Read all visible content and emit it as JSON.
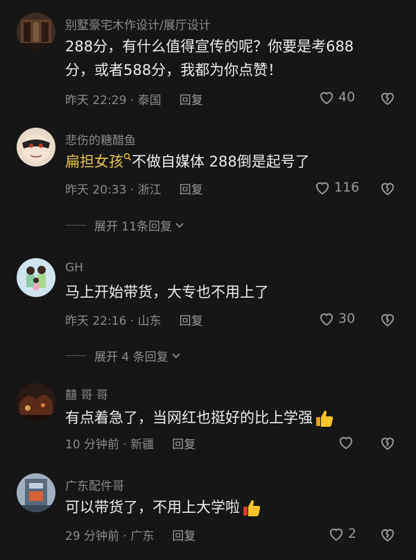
{
  "comments": [
    {
      "username": "别墅豪宅木作设计/展厅设计",
      "text": "288分，有什么值得宣传的呢？你要是考688分，或者588分，我都为你点赞！",
      "meta": "昨天 22:29 · 泰国",
      "reply": "回复",
      "likes": "40"
    },
    {
      "username": "悲伤的糖醋鱼",
      "mention": "扁担女孩",
      "text": "不做自媒体 288倒是起号了",
      "meta": "昨天 20:33 · 浙江",
      "reply": "回复",
      "likes": "116",
      "expand": "展开 11条回复"
    },
    {
      "username": "GH",
      "text": "马上开始带货，大专也不用上了",
      "meta": "昨天 22:16 · 山东",
      "reply": "回复",
      "likes": "30",
      "expand": "展开 4 条回复"
    },
    {
      "username": "囍 哥 哥",
      "text": "有点着急了，当网红也挺好的比上学强",
      "meta": "10 分钟前 · 新疆",
      "reply": "回复",
      "likes": ""
    },
    {
      "username": "广东配件哥",
      "text": "可以带货了，不用上大学啦",
      "meta": "29 分钟前 · 广东",
      "reply": "回复",
      "likes": "2"
    }
  ],
  "colors": {
    "background": "#161616",
    "mention": "#e8c44a",
    "muted": "#8a8a8a"
  }
}
